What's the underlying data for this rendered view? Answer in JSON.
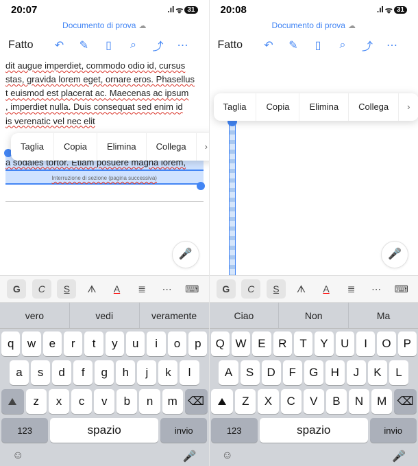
{
  "left": {
    "status": {
      "time": "20:07",
      "signal": ".ıl",
      "wifi": "ᯤ",
      "battery": "31"
    },
    "title": "Documento di prova",
    "done": "Fatto",
    "context": [
      "Taglia",
      "Copia",
      "Elimina",
      "Collega",
      "›"
    ],
    "doc_lines": [
      "dit augue imperdiet, commodo odio id, cursus",
      "stas, gravida lorem eget, ornare eros. Phasellus",
      "t euismod est placerat ac. Maecenas ac ipsum",
      ", imperdiet nulla. Duis consequat sed enim id",
      "is verenatic vel nec elit",
      "a sodales tortor. Etiam posuere magna lorem,"
    ],
    "section_break": "Interruzione di sezione (pagina successiva)",
    "suggestions": [
      "vero",
      "vedi",
      "veramente"
    ],
    "keyrows": [
      [
        "q",
        "w",
        "e",
        "r",
        "t",
        "y",
        "u",
        "i",
        "o",
        "p"
      ],
      [
        "a",
        "s",
        "d",
        "f",
        "g",
        "h",
        "j",
        "k",
        "l"
      ],
      [
        "z",
        "x",
        "c",
        "v",
        "b",
        "n",
        "m"
      ]
    ],
    "numkey": "123",
    "space": "spazio",
    "enter": "invio"
  },
  "right": {
    "status": {
      "time": "20:08",
      "signal": ".ıl",
      "wifi": "ᯤ",
      "battery": "31"
    },
    "title": "Documento di prova",
    "done": "Fatto",
    "context": [
      "Taglia",
      "Copia",
      "Elimina",
      "Collega",
      "›"
    ],
    "suggestions": [
      "Ciao",
      "Non",
      "Ma"
    ],
    "keyrows": [
      [
        "Q",
        "W",
        "E",
        "R",
        "T",
        "Y",
        "U",
        "I",
        "O",
        "P"
      ],
      [
        "A",
        "S",
        "D",
        "F",
        "G",
        "H",
        "J",
        "K",
        "L"
      ],
      [
        "Z",
        "X",
        "C",
        "V",
        "B",
        "N",
        "M"
      ]
    ],
    "numkey": "123",
    "space": "spazio",
    "enter": "invio"
  },
  "fmt": {
    "bold": "G",
    "italic": "C",
    "strike": "S̲"
  }
}
